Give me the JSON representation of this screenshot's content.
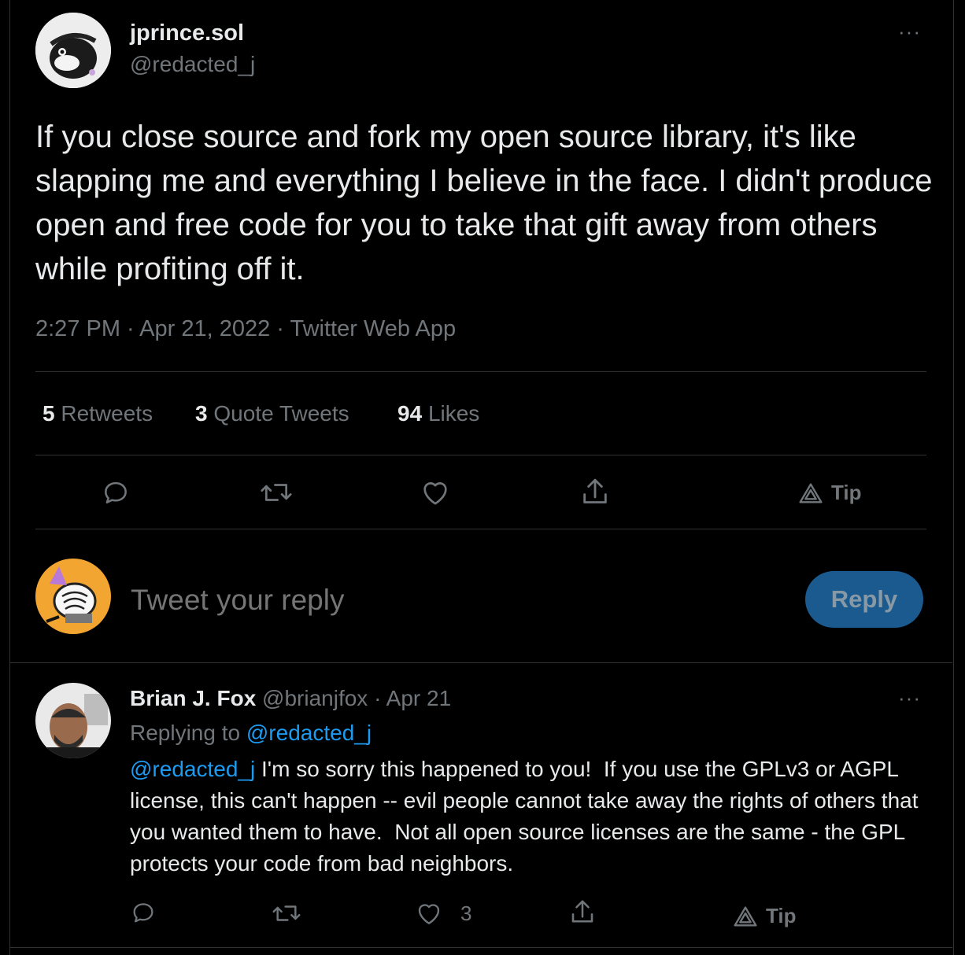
{
  "tweet": {
    "author_name": "jprince.sol",
    "author_handle": "@redacted_j",
    "text": "If you close source and fork my open source library, it's like slapping me and everything I believe in the face. I didn't produce open and free code for you to take that gift away from others while profiting off it.",
    "meta": "2:27 PM · Apr 21, 2022 · Twitter Web App",
    "stats": {
      "retweets_count": "5",
      "retweets_label": "Retweets",
      "quotes_count": "3",
      "quotes_label": "Quote Tweets",
      "likes_count": "94",
      "likes_label": "Likes"
    },
    "actions": {
      "tip_label": "Tip"
    },
    "more_glyph": "···"
  },
  "composer": {
    "placeholder": "Tweet your reply",
    "reply_label": "Reply"
  },
  "reply": {
    "author_name": "Brian J. Fox",
    "author_handle": "@brianjfox",
    "date": "· Apr 21",
    "replying_prefix": "Replying to",
    "replying_to": "@redacted_j",
    "mention": "@redacted_j",
    "text": " I'm so sorry this happened to you!  If you use the GPLv3 or AGPL license, this can't happen -- evil people cannot take away the rights of others that you wanted them to have.  Not all open source licenses are the same - the GPL protects your code from bad neighbors.",
    "like_count": "3",
    "tip_label": "Tip",
    "more_glyph": "···"
  },
  "colors": {
    "background": "#000000",
    "text": "#e7e9ea",
    "muted": "#71767b",
    "link": "#1d9bf0",
    "button": "#1a5a8f"
  },
  "icons": [
    "reply-icon",
    "retweet-icon",
    "like-icon",
    "share-icon",
    "tip-icon",
    "more-icon"
  ]
}
